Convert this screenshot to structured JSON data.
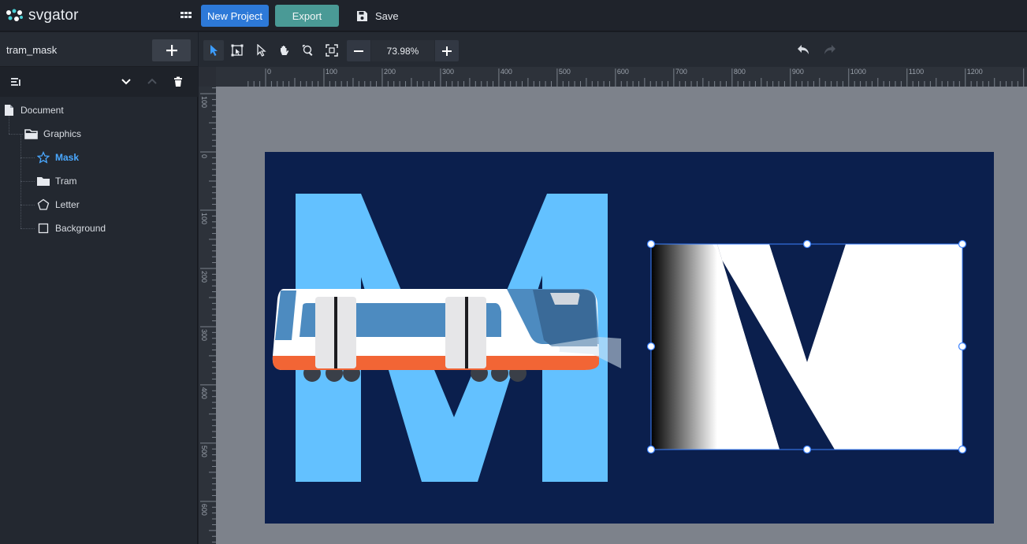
{
  "app": {
    "logo_text": "svgator",
    "new_project_label": "New Project",
    "export_label": "Export",
    "save_label": "Save"
  },
  "sidebar": {
    "project_name": "tram_mask",
    "tree": [
      {
        "label": "Document",
        "icon": "document-icon",
        "level": 0
      },
      {
        "label": "Graphics",
        "icon": "folder-open-icon",
        "level": 1
      },
      {
        "label": "Mask",
        "icon": "star-icon",
        "level": 2,
        "active": true
      },
      {
        "label": "Tram",
        "icon": "folder-icon",
        "level": 2
      },
      {
        "label": "Letter",
        "icon": "pentagon-icon",
        "level": 2
      },
      {
        "label": "Background",
        "icon": "square-icon",
        "level": 2
      }
    ]
  },
  "toolbar": {
    "zoom": "73.98%"
  },
  "rulers": {
    "horizontal": [
      "0",
      "100",
      "200",
      "300",
      "400",
      "500",
      "600",
      "700",
      "800",
      "900",
      "1000",
      "1100",
      "1200"
    ],
    "vertical": [
      "100",
      "0",
      "100",
      "200",
      "300",
      "400",
      "500",
      "600"
    ]
  },
  "colors": {
    "accent": "#2d79d8",
    "export": "#4a9a96",
    "artboard": "#0b1f4d",
    "letter_m": "#63c1ff",
    "active_layer": "#4aa8ff",
    "tram_orange": "#f26535",
    "tram_blue": "#4d8bc0"
  }
}
